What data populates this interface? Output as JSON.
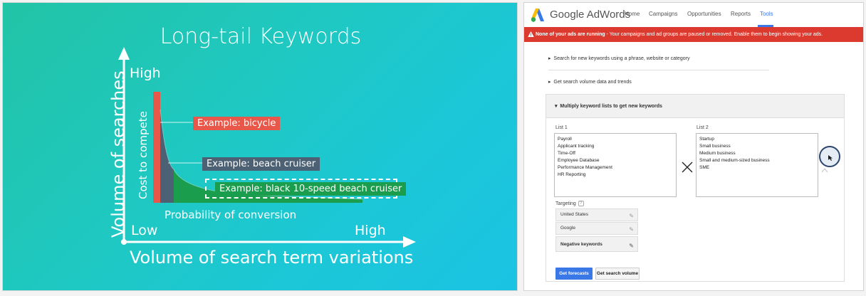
{
  "slide": {
    "title": "Long-tail Keywords",
    "y_axis_title": "Volume of searches",
    "y_high": "High",
    "y_sub_label": "Cost to compete",
    "x_low": "Low",
    "x_high": "High",
    "x_sub_label": "Probability of conversion",
    "x_axis_title": "Volume of search term variations",
    "examples": [
      {
        "label": "Example: bicycle",
        "color": "#e8584a"
      },
      {
        "label": "Example: beach cruiser",
        "color": "#4c6174"
      },
      {
        "label": "Example: black 10-speed beach cruiser",
        "color": "#1a9d4c"
      }
    ]
  },
  "adwords": {
    "logo": "Google AdWords",
    "nav": [
      "Home",
      "Campaigns",
      "Opportunities",
      "Reports",
      "Tools"
    ],
    "active_nav": "Tools",
    "banner_bold": "None of your ads are running",
    "banner_text": " - Your campaigns and ad groups are paused or removed. Enable them to begin showing your ads.",
    "links": [
      "Search for new keywords using a phrase, website or category",
      "Get search volume data and trends"
    ],
    "panel_title": "Multiply keyword lists to get new keywords",
    "list1_label": "List 1",
    "list1": [
      "Payroll",
      "Applicant tracking",
      "Time-Off",
      "Employee Database",
      "Performance Management",
      "HR Reporting"
    ],
    "list2_label": "List 2",
    "list2": [
      "Startup",
      "Small business",
      "Medium business",
      "Small and medium-sized business",
      "SME"
    ],
    "targeting_label": "Targeting",
    "targeting_help": "?",
    "targeting": [
      "United States",
      "Google",
      "Negative keywords"
    ],
    "primary_button": "Get forecasts",
    "secondary_button": "Get search volume",
    "accent": "#3b78e7",
    "banner_color": "#dd3a2f"
  }
}
